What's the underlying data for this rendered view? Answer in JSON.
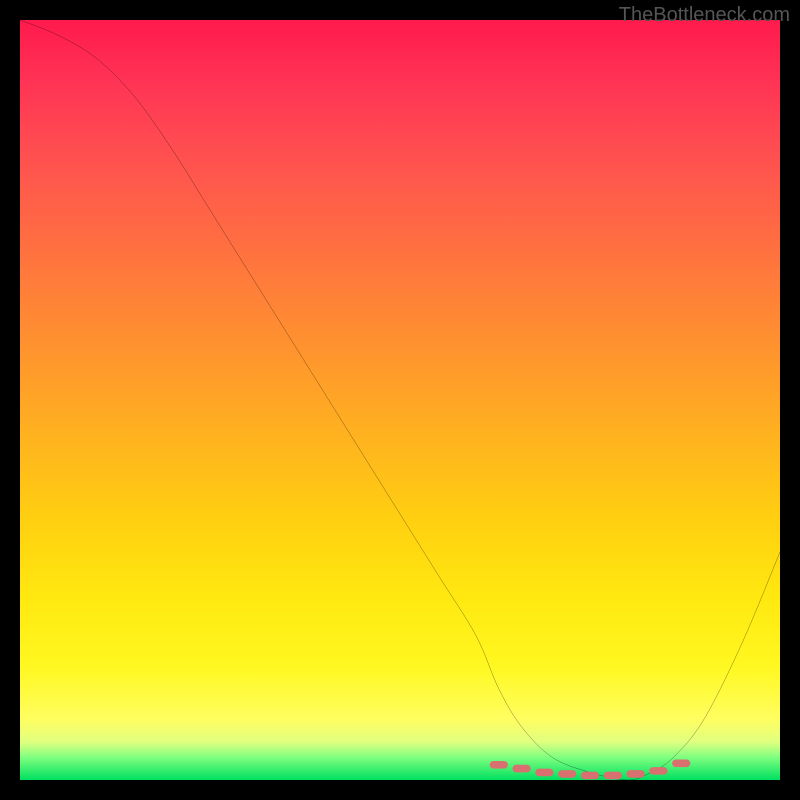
{
  "watermark": "TheBottleneck.com",
  "chart_data": {
    "type": "line",
    "title": "",
    "xlabel": "",
    "ylabel": "",
    "xlim": [
      0,
      100
    ],
    "ylim": [
      0,
      100
    ],
    "series": [
      {
        "name": "bottleneck-curve",
        "x": [
          0,
          5,
          10,
          15,
          20,
          25,
          30,
          35,
          40,
          45,
          50,
          55,
          60,
          63,
          66,
          70,
          75,
          80,
          83,
          86,
          90,
          95,
          100
        ],
        "y": [
          100,
          98,
          95,
          90,
          83,
          75,
          67,
          59,
          51,
          43,
          35,
          27,
          19,
          12,
          7,
          3,
          1,
          0,
          1,
          3,
          8,
          18,
          30
        ]
      }
    ],
    "markers": {
      "name": "optimal-range",
      "color": "#d97070",
      "points_x": [
        63,
        66,
        69,
        72,
        75,
        78,
        81,
        84,
        87
      ],
      "points_y": [
        2,
        1.5,
        1,
        0.8,
        0.6,
        0.6,
        0.8,
        1.2,
        2.2
      ]
    },
    "gradient_stops": [
      {
        "pos": 0,
        "color": "#ff1a4d"
      },
      {
        "pos": 50,
        "color": "#ffb020"
      },
      {
        "pos": 90,
        "color": "#fffe60"
      },
      {
        "pos": 100,
        "color": "#00e060"
      }
    ]
  }
}
